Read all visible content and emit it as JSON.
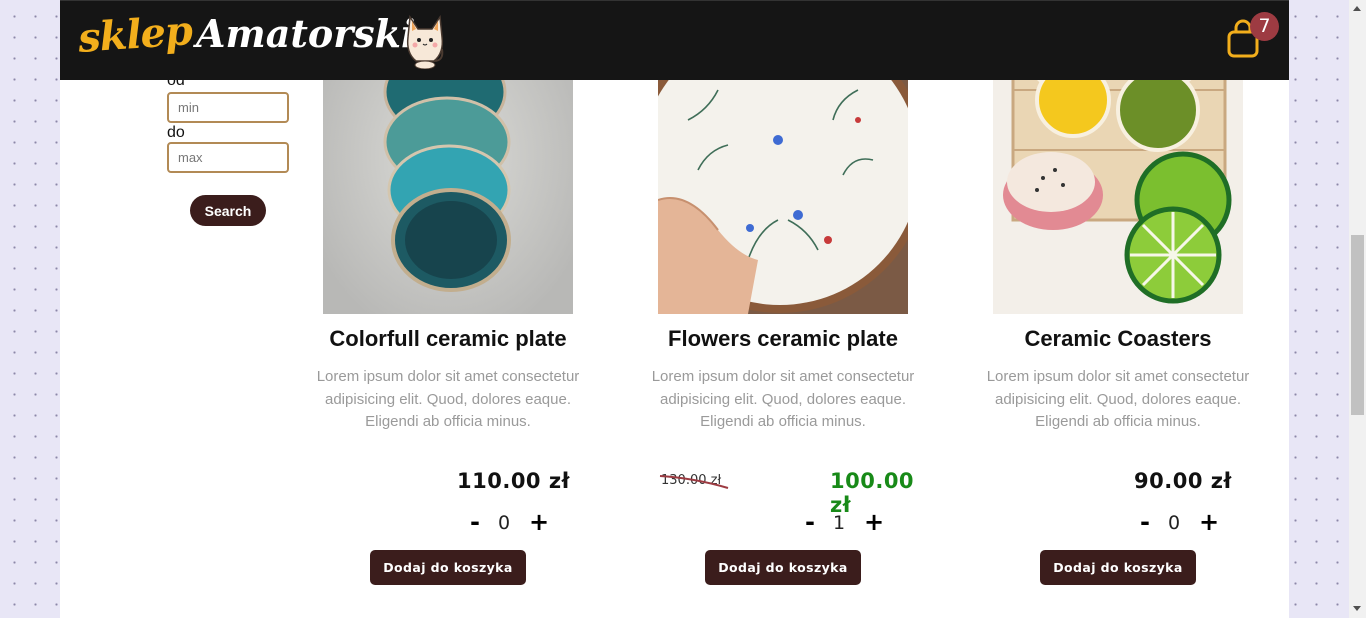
{
  "header": {
    "logo_part1": "sklep",
    "logo_part2": "Amatorski",
    "cart_count": "7"
  },
  "filter": {
    "from_label": "od",
    "to_label": "do",
    "min_placeholder": "min",
    "max_placeholder": "max",
    "search_label": "Search"
  },
  "products": [
    {
      "title": "Colorfull ceramic plate",
      "description": "Lorem ipsum dolor sit amet consectetur adipisicing elit. Quod, dolores eaque. Eligendi ab officia minus.",
      "price": "110.00 zł",
      "quantity": "0",
      "minus": "-",
      "plus": "+",
      "add_label": "Dodaj do koszyka"
    },
    {
      "title": "Flowers ceramic plate",
      "description": "Lorem ipsum dolor sit amet consectetur adipisicing elit. Quod, dolores eaque. Eligendi ab officia minus.",
      "old_price": "130.00 zł",
      "price": "100.00 zł",
      "quantity": "1",
      "minus": "-",
      "plus": "+",
      "add_label": "Dodaj do koszyka"
    },
    {
      "title": "Ceramic Coasters",
      "description": "Lorem ipsum dolor sit amet consectetur adipisicing elit. Quod, dolores eaque. Eligendi ab officia minus.",
      "price": "90.00 zł",
      "quantity": "0",
      "minus": "-",
      "plus": "+",
      "add_label": "Dodaj do koszyka"
    }
  ],
  "colors": {
    "header_bg": "#151515",
    "logo_accent": "#f2ae1c",
    "button_bg": "#3b1d1c",
    "badge_bg": "#9d3b42",
    "sale_price": "#188a18",
    "input_border": "#b28a55"
  },
  "icons": {
    "cart": "shopping-bag-icon",
    "logo_mascot": "cat-icon"
  }
}
